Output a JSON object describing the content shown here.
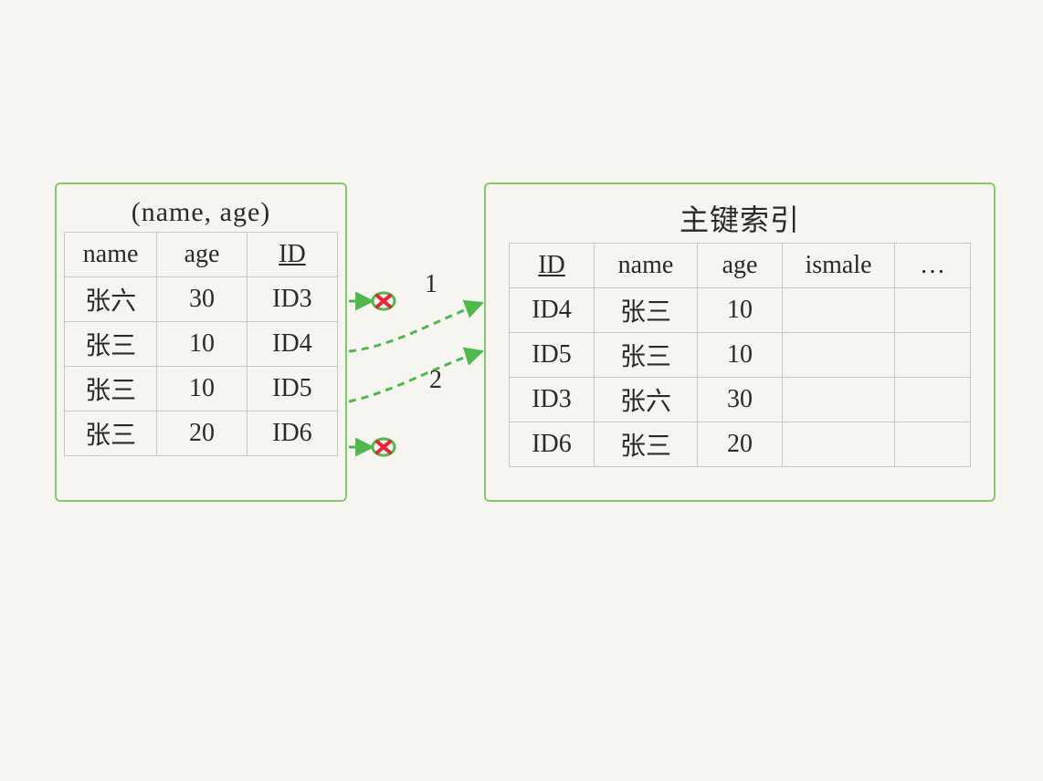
{
  "left": {
    "title": "(name, age)",
    "headers": [
      "name",
      "age",
      "ID"
    ],
    "rows": [
      {
        "name": "张六",
        "age": "30",
        "id": "ID3"
      },
      {
        "name": "张三",
        "age": "10",
        "id": "ID4"
      },
      {
        "name": "张三",
        "age": "10",
        "id": "ID5"
      },
      {
        "name": "张三",
        "age": "20",
        "id": "ID6"
      }
    ]
  },
  "right": {
    "title": "主键索引",
    "headers": [
      "ID",
      "name",
      "age",
      "ismale",
      "…"
    ],
    "rows": [
      {
        "id": "ID4",
        "name": "张三",
        "age": "10",
        "ismale": "",
        "extra": ""
      },
      {
        "id": "ID5",
        "name": "张三",
        "age": "10",
        "ismale": "",
        "extra": ""
      },
      {
        "id": "ID3",
        "name": "张六",
        "age": "30",
        "ismale": "",
        "extra": ""
      },
      {
        "id": "ID6",
        "name": "张三",
        "age": "20",
        "ismale": "",
        "extra": ""
      }
    ]
  },
  "arrows": {
    "label1": "1",
    "label2": "2"
  }
}
